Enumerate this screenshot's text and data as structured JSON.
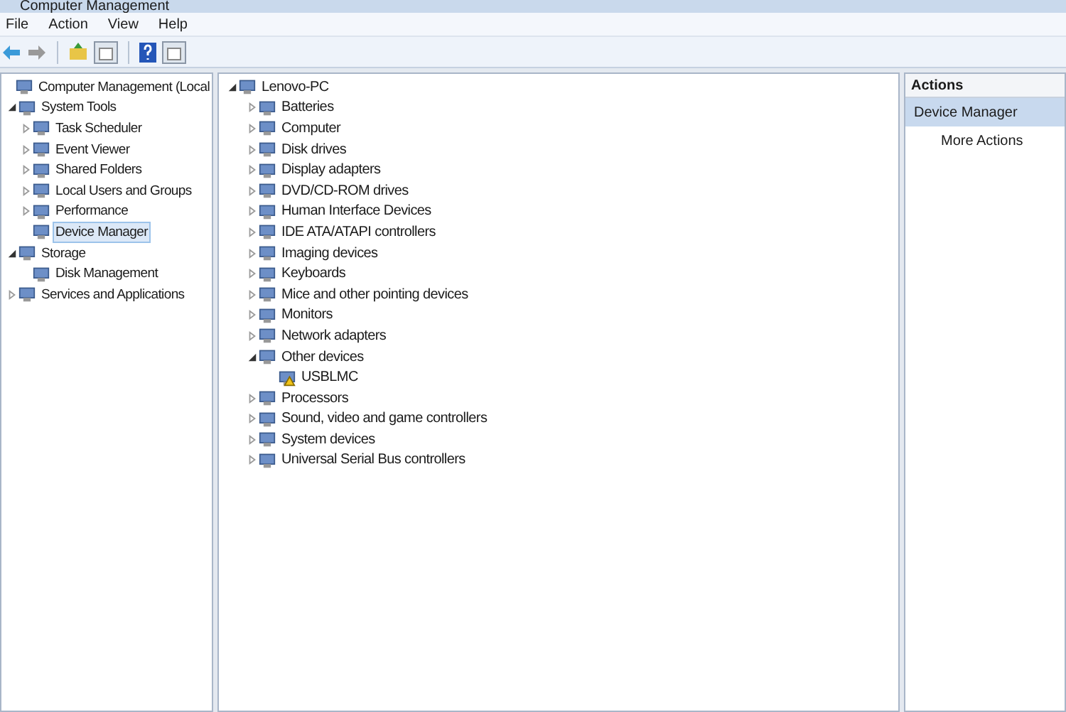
{
  "window": {
    "title": "Computer Management"
  },
  "menu": [
    "File",
    "Action",
    "View",
    "Help"
  ],
  "left_tree": [
    {
      "label": "Computer Management (Local",
      "children": [
        {
          "label": "System Tools",
          "expanded": true,
          "children": [
            {
              "label": "Task Scheduler",
              "expanded": false,
              "selected": false
            },
            {
              "label": "Event Viewer",
              "expanded": false,
              "selected": false
            },
            {
              "label": "Shared Folders",
              "expanded": false,
              "selected": false
            },
            {
              "label": "Local Users and Groups",
              "expanded": false,
              "selected": false
            },
            {
              "label": "Performance",
              "expanded": false,
              "selected": false
            },
            {
              "label": "Device Manager",
              "selected": true
            }
          ]
        },
        {
          "label": "Storage",
          "expanded": true,
          "children": [
            {
              "label": "Disk Management",
              "selected": false
            }
          ]
        },
        {
          "label": "Services and Applications",
          "expanded": false,
          "selected": false
        }
      ]
    }
  ],
  "device_tree": [
    {
      "label": "Lenovo-PC",
      "expanded": true,
      "children": [
        {
          "label": "Batteries",
          "expanded": false
        },
        {
          "label": "Computer",
          "expanded": false
        },
        {
          "label": "Disk drives",
          "expanded": false
        },
        {
          "label": "Display adapters",
          "expanded": false
        },
        {
          "label": "DVD/CD-ROM drives",
          "expanded": false
        },
        {
          "label": "Human Interface Devices",
          "expanded": false
        },
        {
          "label": "IDE ATA/ATAPI controllers",
          "expanded": false
        },
        {
          "label": "Imaging devices",
          "expanded": false
        },
        {
          "label": "Keyboards",
          "expanded": false
        },
        {
          "label": "Mice and other pointing devices",
          "expanded": false
        },
        {
          "label": "Monitors",
          "expanded": false
        },
        {
          "label": "Network adapters",
          "expanded": false
        },
        {
          "label": "Other devices",
          "expanded": true,
          "children": [
            {
              "label": "USBLMC",
              "warning": true
            }
          ]
        },
        {
          "label": "Processors",
          "expanded": false
        },
        {
          "label": "Sound, video and game controllers",
          "expanded": false
        },
        {
          "label": "System devices",
          "expanded": false
        },
        {
          "label": "Universal Serial Bus controllers",
          "expanded": false
        }
      ]
    }
  ],
  "actions": {
    "header": "Actions",
    "section": "Device Manager",
    "items": [
      "More Actions"
    ]
  }
}
